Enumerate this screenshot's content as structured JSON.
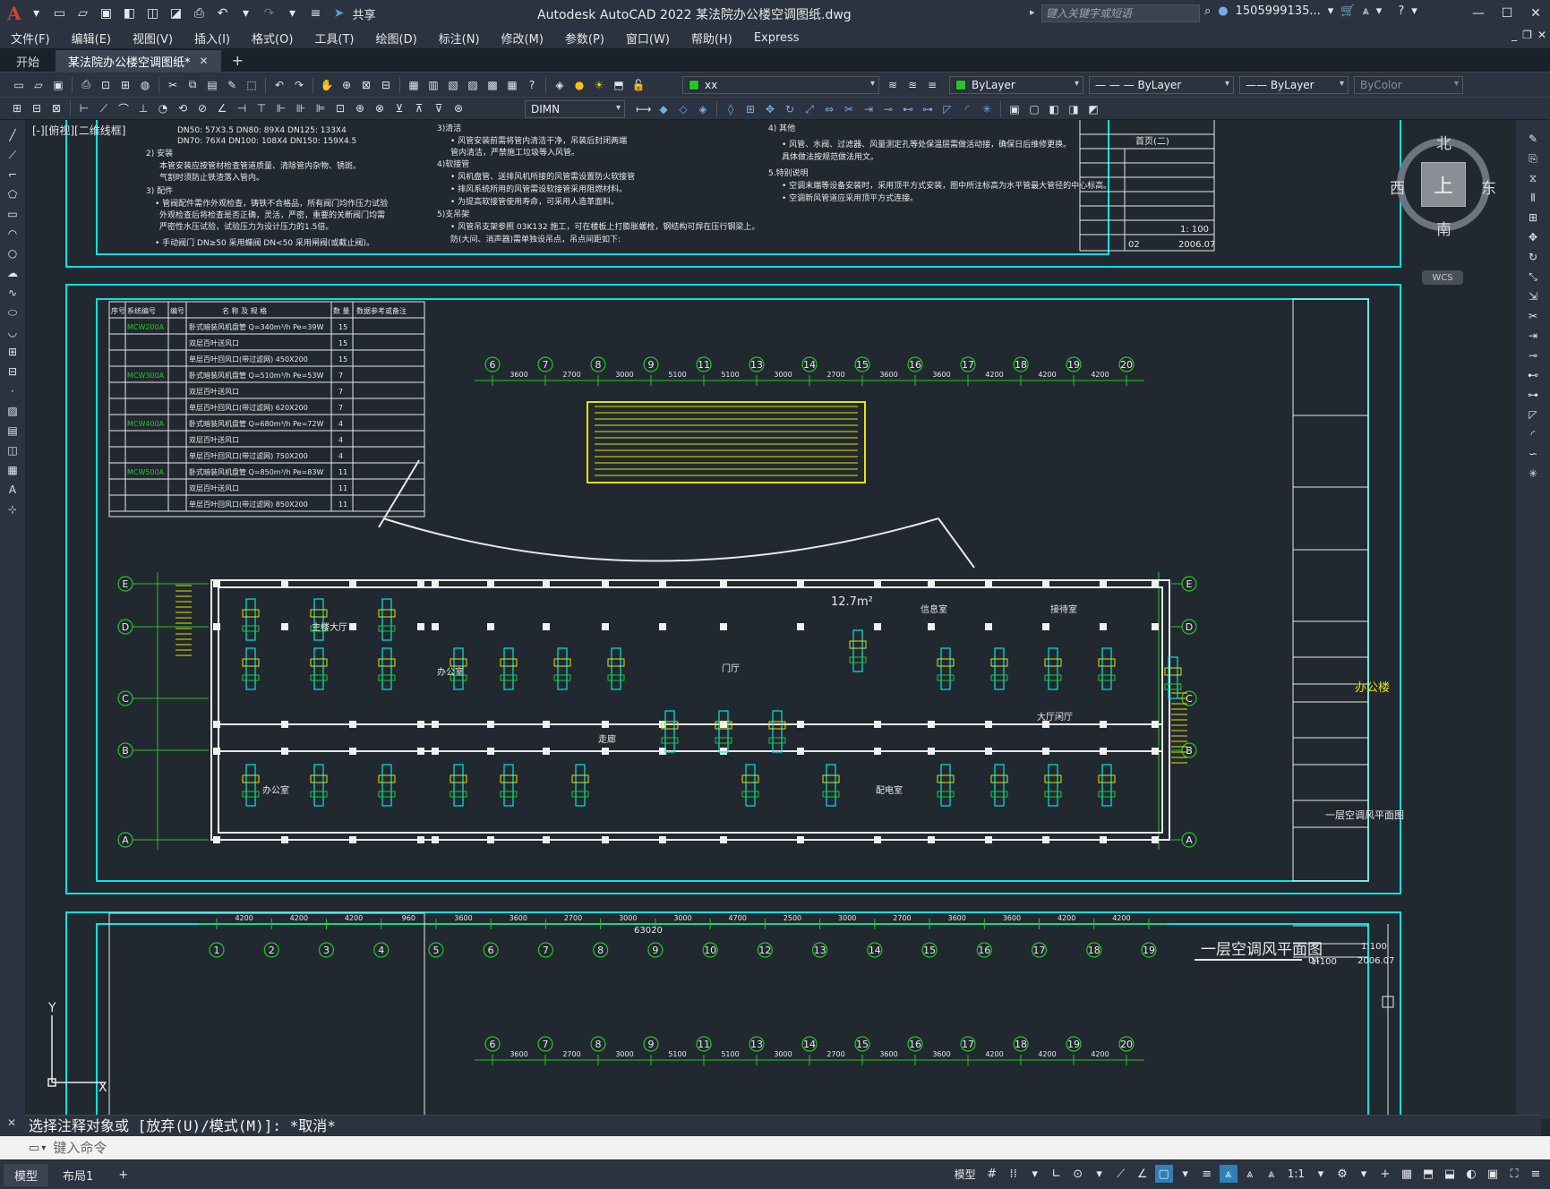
{
  "titlebar": {
    "logo": "A",
    "share_label": "共享",
    "title": "Autodesk AutoCAD 2022    某法院办公楼空调图纸.dwg",
    "search_placeholder": "键入关键字或短语",
    "username": "1505999135...",
    "minimize_glyph": "—",
    "maximize_glyph": "☐",
    "close_glyph": "✕"
  },
  "menu": [
    "文件(F)",
    "编辑(E)",
    "视图(V)",
    "插入(I)",
    "格式(O)",
    "工具(T)",
    "绘图(D)",
    "标注(N)",
    "修改(M)",
    "参数(P)",
    "窗口(W)",
    "帮助(H)",
    "Express"
  ],
  "tabs": [
    {
      "label": "开始",
      "active": false
    },
    {
      "label": "某法院办公楼空调图纸*",
      "active": true
    }
  ],
  "toolbar": {
    "layer_name": "xx",
    "color_value": "ByLayer",
    "linetype_value": "— — —  ByLayer",
    "lineweight_value": "—— ByLayer",
    "plotstyle_value": "ByColor",
    "dimstyle_value": "DIMN",
    "layer_color": "#22c822",
    "color_swatch": "#22c822"
  },
  "viewport_label": "[-][俯视][二维线框]",
  "viewcube": {
    "north": "北",
    "south": "南",
    "east": "东",
    "west": "西",
    "face": "上",
    "wcs": "WCS"
  },
  "drawing": {
    "plan_title": "一层空调风平面图",
    "plan_scale": "1:100",
    "room_area": "12.7m²",
    "total_dim": "63020",
    "top_axes": [
      "6",
      "7",
      "8",
      "9",
      "11",
      "13",
      "14",
      "15",
      "16",
      "17",
      "18",
      "19",
      "20"
    ],
    "bottom_axes": [
      "1",
      "2",
      "3",
      "4",
      "5",
      "6",
      "7",
      "8",
      "9",
      "10",
      "12",
      "13",
      "14",
      "15",
      "16",
      "17",
      "18",
      "19"
    ],
    "row_axes": [
      "E",
      "D",
      "C",
      "B",
      "A"
    ],
    "top_dims": [
      "3600",
      "2700",
      "3000",
      "5100",
      "5100",
      "3000",
      "2700",
      "3600",
      "3600",
      "4200",
      "4200",
      "4200"
    ],
    "bottom_dims": [
      "4200",
      "4200",
      "4200",
      "960",
      "3600",
      "3600",
      "2700",
      "3000",
      "3000",
      "4700",
      "2500",
      "3000",
      "2700",
      "3600",
      "3600",
      "4200",
      "4200",
      "4200"
    ],
    "table_headers": [
      "序号",
      "系统编号",
      "编号",
      "名 称 及 规 格",
      "数 量",
      "数据参考或备注"
    ],
    "table_rows": [
      {
        "sys": "MCW200A",
        "name": "卧式暗装风机盘管  Q=340m³/h   Pe=39W",
        "qty": "15"
      },
      {
        "sys": "",
        "name": "双层百叶送风口",
        "qty": "15"
      },
      {
        "sys": "",
        "name": "单层百叶回风口(带过滤网) 450X200",
        "qty": "15"
      },
      {
        "sys": "MCW300A",
        "name": "卧式暗装风机盘管  Q=510m³/h   Pe=53W",
        "qty": "7"
      },
      {
        "sys": "",
        "name": "双层百叶送风口",
        "qty": "7"
      },
      {
        "sys": "",
        "name": "单层百叶回风口(带过滤网) 620X200",
        "qty": "7"
      },
      {
        "sys": "MCW400A",
        "name": "卧式暗装风机盘管  Q=680m³/h   Pe=72W",
        "qty": "4"
      },
      {
        "sys": "",
        "name": "双层百叶送风口",
        "qty": "4"
      },
      {
        "sys": "",
        "name": "单层百叶回风口(带过滤网) 750X200",
        "qty": "4"
      },
      {
        "sys": "MCW500A",
        "name": "卧式暗装风机盘管  Q=850m³/h   Pe=83W",
        "qty": "11"
      },
      {
        "sys": "",
        "name": "双层百叶送风口",
        "qty": "11"
      },
      {
        "sys": "",
        "name": "单层百叶回风口(带过滤网) 850X200",
        "qty": "11"
      }
    ],
    "room_labels": [
      "主楼大厅",
      "办公室",
      "门厅",
      "大厅闲厅",
      "办公室",
      "信息室",
      "配电室",
      "接待室",
      "走廊"
    ],
    "title_block": {
      "project": "办公楼",
      "sheet": "一层空调风平面图",
      "scale": "1:100",
      "date": "2006.07",
      "sheet_no": "04"
    },
    "top_title_block": {
      "sheet": "首页(二)",
      "scale": "1: 100",
      "date": "2006.07",
      "sheet_no": "02"
    }
  },
  "command": {
    "history": "选择注释对象或 [放弃(U)/模式(M)]: *取消*",
    "placeholder": "键入命令"
  },
  "status": {
    "layouts": [
      "模型",
      "布局1"
    ],
    "model_label": "模型",
    "scale": "1:1"
  }
}
